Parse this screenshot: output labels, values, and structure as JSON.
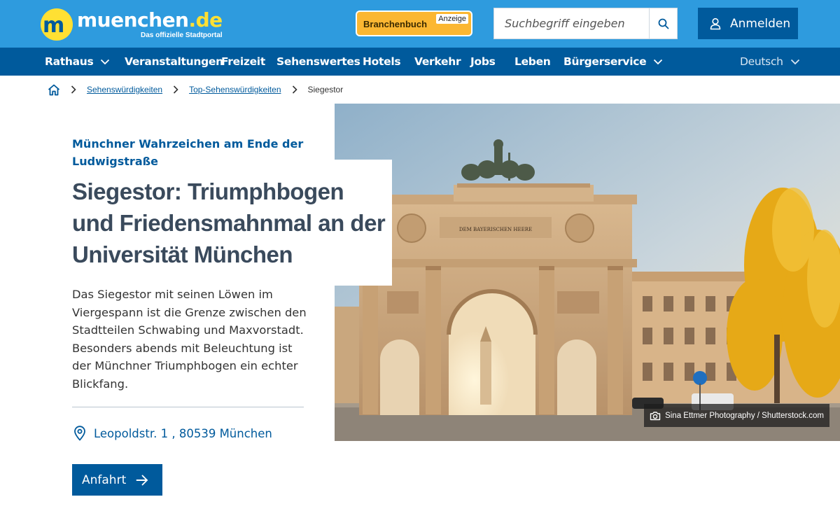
{
  "header": {
    "logo_name_main": "muenchen",
    "logo_name_tld": ".de",
    "logo_subtitle": "Das offizielle Stadtportal",
    "branchenbuch_label": "Branchenbuch",
    "branchenbuch_badge": "Anzeige",
    "search_placeholder": "Suchbegriff eingeben",
    "login_label": "Anmelden"
  },
  "nav": {
    "items": [
      {
        "label": "Rathaus",
        "has_dropdown": true
      },
      {
        "label": "Veranstaltungen",
        "has_dropdown": false
      },
      {
        "label": "Freizeit",
        "has_dropdown": false
      },
      {
        "label": "Sehenswertes",
        "has_dropdown": false
      },
      {
        "label": "Hotels",
        "has_dropdown": false
      },
      {
        "label": "Verkehr",
        "has_dropdown": false
      },
      {
        "label": "Jobs",
        "has_dropdown": false
      },
      {
        "label": "Leben",
        "has_dropdown": false
      },
      {
        "label": "Bürgerservice",
        "has_dropdown": true
      }
    ],
    "language": "Deutsch"
  },
  "breadcrumb": {
    "items": [
      "Sehenswürdigkeiten",
      "Top-Sehenswürdigkeiten"
    ],
    "current": "Siegestor"
  },
  "article": {
    "kicker": "Münchner Wahrzeichen am Ende der Ludwigstraße",
    "title": "Siegestor: Triumphbogen und Friedensmahnmal an der Universität München",
    "lead": "Das Siegestor mit seinen Löwen im Viergespann ist die Grenze zwischen den Stadtteilen Schwabing und Maxvorstadt. Besonders abends mit Beleuchtung ist der Münchner Triumphbogen ein echter Blickfang.",
    "address": "Leopoldstr. 1 , 80539 München",
    "directions_label": "Anfahrt"
  },
  "hero": {
    "image_credit": "Sina Ettmer Photography / Shutterstock.com",
    "inscription": "DEM BAYERISCHEN HEERE"
  },
  "colors": {
    "header_blue": "#2e9bde",
    "nav_blue": "#005a9c",
    "logo_yellow": "#ffe033",
    "branchenbuch_orange": "#fbb732",
    "title_gray": "#3a4a5c"
  }
}
